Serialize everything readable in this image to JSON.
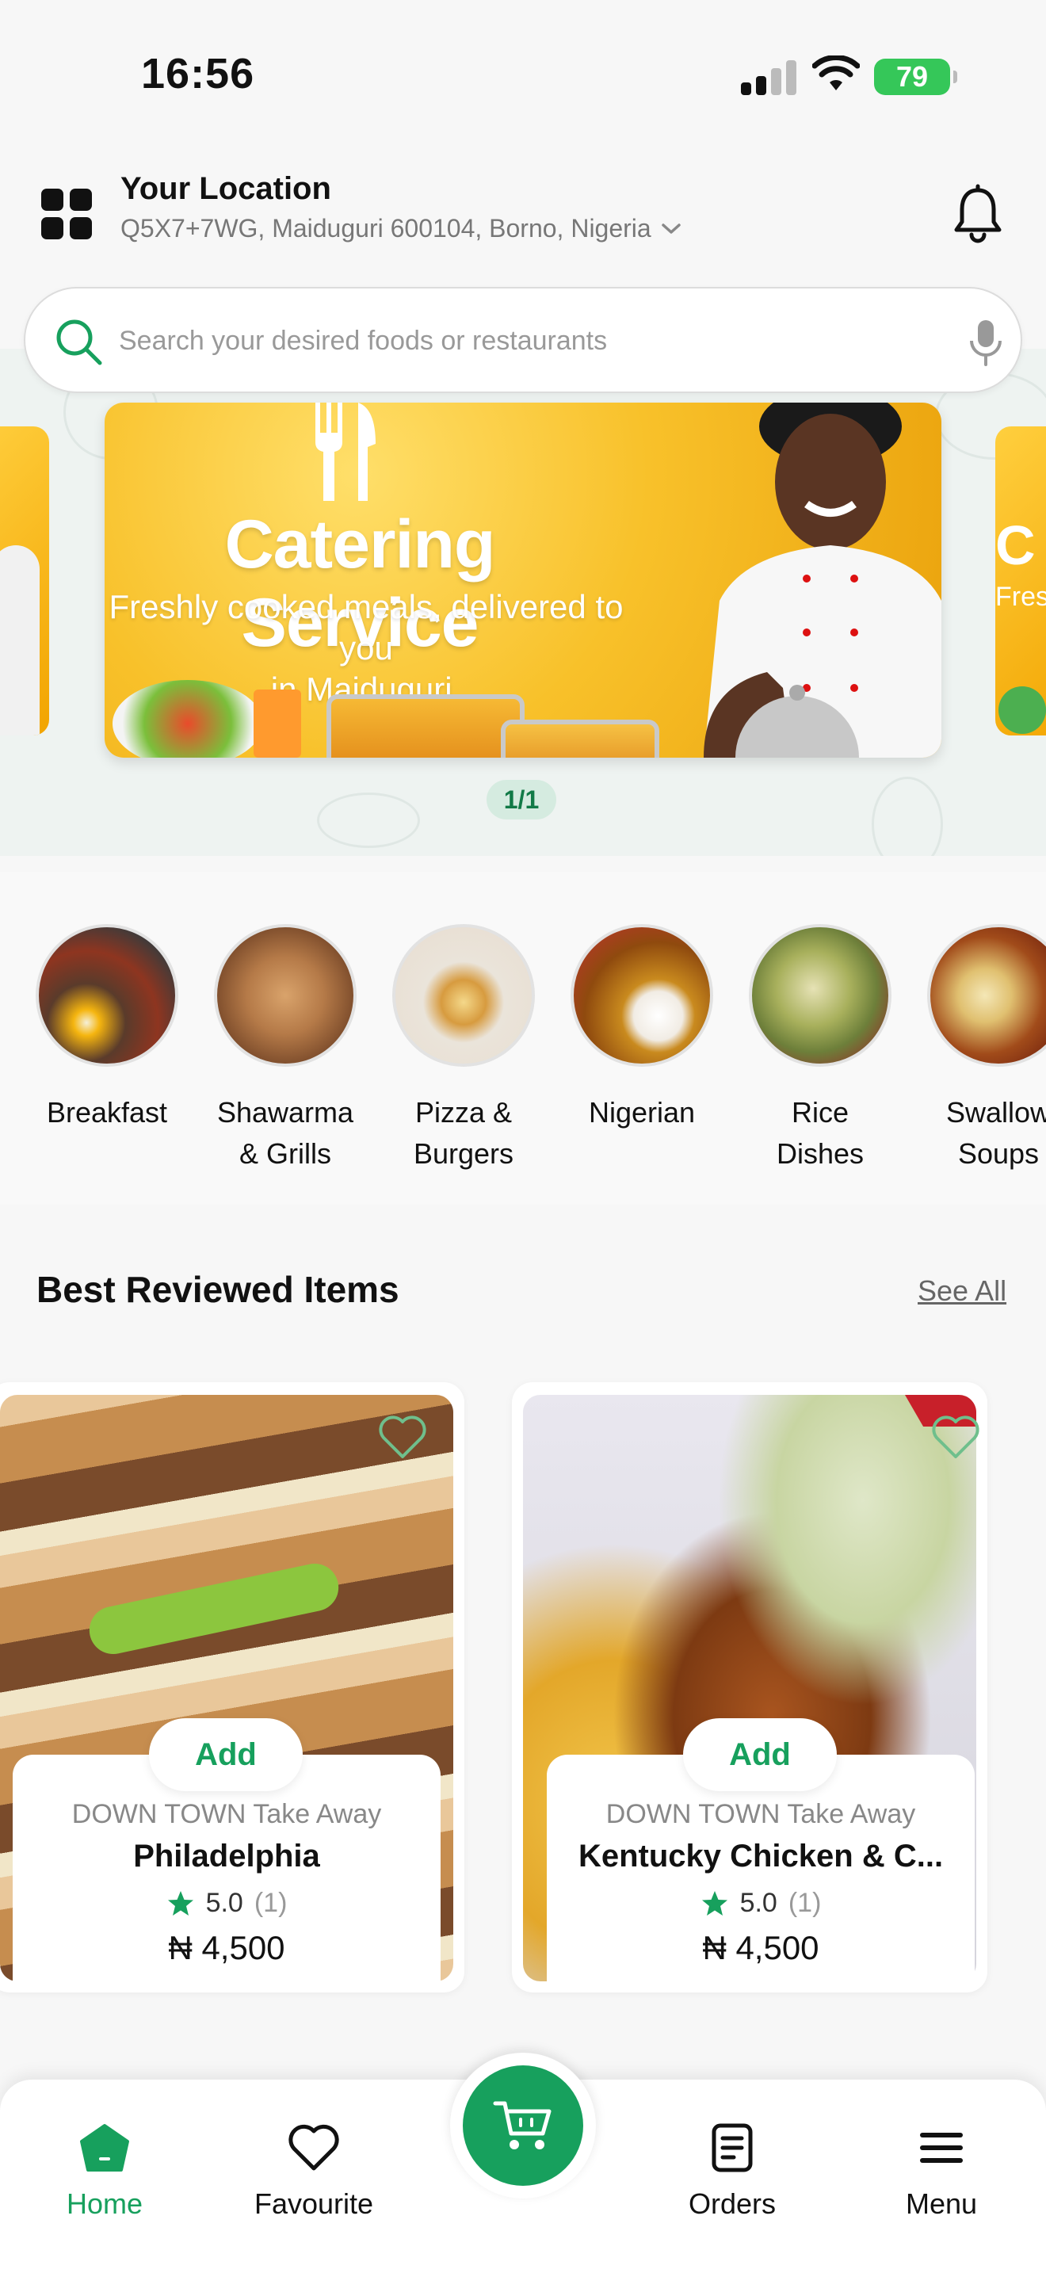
{
  "status_bar": {
    "time": "16:56",
    "battery": "79"
  },
  "header": {
    "location_title": "Your Location",
    "location_address": "Q5X7+7WG, Maiduguri 600104, Borno, Nigeria"
  },
  "search": {
    "placeholder": "Search your desired foods or restaurants"
  },
  "banner": {
    "title": "Catering Service",
    "subtitle_line1": "Freshly cooked meals, delivered to you",
    "subtitle_line2": "in Maiduguri.",
    "side_letter": "C",
    "side_sub": "Fres",
    "pager": "1/1"
  },
  "categories": [
    {
      "line1": "Breakfast",
      "line2": ""
    },
    {
      "line1": "Shawarma",
      "line2": "& Grills"
    },
    {
      "line1": "Pizza &",
      "line2": "Burgers"
    },
    {
      "line1": "Nigerian",
      "line2": ""
    },
    {
      "line1": "Rice",
      "line2": "Dishes"
    },
    {
      "line1": "Swallow",
      "line2": "Soups"
    }
  ],
  "best_reviewed": {
    "title": "Best Reviewed Items",
    "see_all": "See All",
    "items": [
      {
        "add": "Add",
        "store": "DOWN TOWN Take Away",
        "name": "Philadelphia",
        "rating": "5.0",
        "count": "(1)",
        "price": "₦ 4,500"
      },
      {
        "add": "Add",
        "store": "DOWN TOWN Take Away",
        "name": "Kentucky Chicken & C...",
        "rating": "5.0",
        "count": "(1)",
        "price": "₦ 4,500"
      }
    ]
  },
  "nav": {
    "home": "Home",
    "favourite": "Favourite",
    "orders": "Orders",
    "menu": "Menu"
  },
  "colors": {
    "brand_green": "#17a05d",
    "banner_yellow": "#f8c12a"
  }
}
